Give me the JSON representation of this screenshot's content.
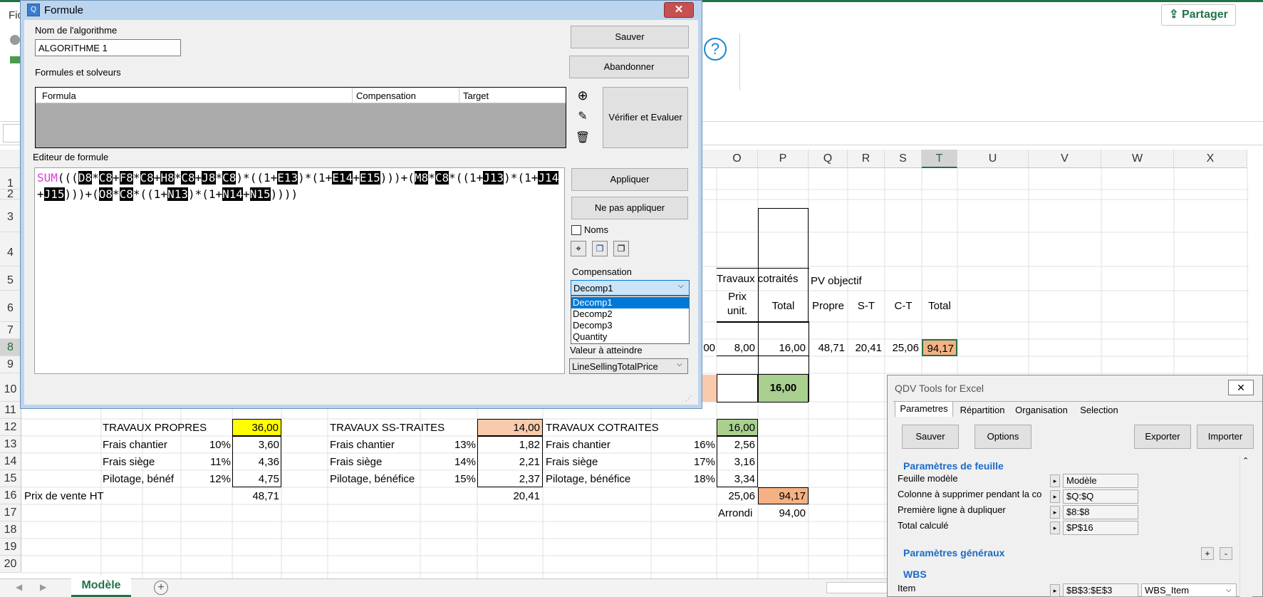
{
  "excel": {
    "ribbon_fragment_top": "Fic",
    "share_label": "Partager",
    "columns": [
      "O",
      "P",
      "Q",
      "R",
      "S",
      "T",
      "U",
      "V",
      "W",
      "X"
    ],
    "rows": [
      "1",
      "2",
      "3",
      "4",
      "5",
      "6",
      "7",
      "8",
      "9",
      "10",
      "11",
      "12",
      "13",
      "14",
      "15",
      "16",
      "17",
      "18",
      "19",
      "20"
    ],
    "header_block": {
      "travaux_cotraites": "Travaux cotraités",
      "pv_objectif": "PV objectif",
      "prix_unit": "Prix unit.",
      "total": "Total",
      "propre": "Propre",
      "st": "S-T",
      "ct": "C-T",
      "total2": "Total"
    },
    "row8": {
      "n_partial": "00",
      "o": "8,00",
      "p": "16,00",
      "q": "48,71",
      "r": "20,41",
      "s": "25,06",
      "t": "94,17"
    },
    "row10": {
      "p": "16,00"
    },
    "summary": {
      "col1": {
        "title": "TRAVAUX PROPRES",
        "title_value": "36,00",
        "lines": [
          {
            "label": "Frais chantier",
            "pct": "10%",
            "value": "3,60"
          },
          {
            "label": "Frais siège",
            "pct": "11%",
            "value": "4,36"
          },
          {
            "label": "Pilotage, bénéf",
            "pct": "12%",
            "value": "4,75"
          }
        ],
        "total": "48,71"
      },
      "col2": {
        "title": "TRAVAUX SS-TRAITES",
        "title_value": "14,00",
        "lines": [
          {
            "label": "Frais chantier",
            "pct": "13%",
            "value": "1,82"
          },
          {
            "label": "Frais siège",
            "pct": "14%",
            "value": "2,21"
          },
          {
            "label": "Pilotage, bénéfice",
            "pct": "15%",
            "value": "2,37"
          }
        ],
        "total": "20,41"
      },
      "col3": {
        "title": "TRAVAUX COTRAITES",
        "title_value": "16,00",
        "lines": [
          {
            "label": "Frais chantier",
            "pct": "16%",
            "value": "2,56"
          },
          {
            "label": "Frais siège",
            "pct": "17%",
            "value": "3,16"
          },
          {
            "label": "Pilotage, bénéfice",
            "pct": "18%",
            "value": "3,34"
          }
        ],
        "total": "25,06"
      },
      "prix_vente_label": "Prix de vente HT",
      "grand_total": "94,17",
      "arrondi_label": "Arrondi",
      "arrondi_value": "94,00"
    },
    "sheet_tab": "Modèle"
  },
  "dialog": {
    "title": "Formule",
    "close": "✕",
    "algo_name_label": "Nom de l'algorithme",
    "algo_name_value": "ALGORITHME 1",
    "formulas_label": "Formules et solveurs",
    "grid_columns": [
      "Formula",
      "Compensation",
      "Target"
    ],
    "editor_label": "Editeur de formule",
    "buttons": {
      "save": "Sauver",
      "abandon": "Abandonner",
      "verify": "Vérifier et Evaluer",
      "apply": "Appliquer",
      "no_apply": "Ne pas appliquer"
    },
    "names_label": "Noms",
    "compensation_label": "Compensation",
    "compensation_value": "Decomp1",
    "compensation_options": [
      "Decomp1",
      "Decomp2",
      "Decomp3",
      "Quantity"
    ],
    "target_label": "Valeur à atteindre",
    "target_value": "LineSellingTotalPrice"
  },
  "qdv": {
    "title": "QDV Tools for Excel",
    "tabs": [
      "Parametres",
      "Répartition",
      "Organisation",
      "Selection"
    ],
    "buttons": {
      "save": "Sauver",
      "options": "Options",
      "export": "Exporter",
      "import": "Importer"
    },
    "sheet_params_title": "Paramètres de feuille",
    "params": [
      {
        "label": "Feuille modèle",
        "value": "Modèle"
      },
      {
        "label": "Colonne à supprimer pendant la co",
        "value": "$Q:$Q"
      },
      {
        "label": "Première ligne à dupliquer",
        "value": "$8:$8"
      },
      {
        "label": "Total calculé",
        "value": "$P$16"
      }
    ],
    "general_params_title": "Paramètres généraux",
    "plus": "+",
    "minus": "-",
    "wbs_title": "WBS",
    "item_label": "Item",
    "item_value": "$B$3:$E$3",
    "item_select": "WBS_Item"
  },
  "colors": {
    "excel_green": "#217346",
    "yellow": "#ffff00",
    "peach": "#f8cbad",
    "green_cell": "#a9d08e",
    "orange_cell": "#f4b183",
    "formula_fn": "#d63ed6"
  }
}
